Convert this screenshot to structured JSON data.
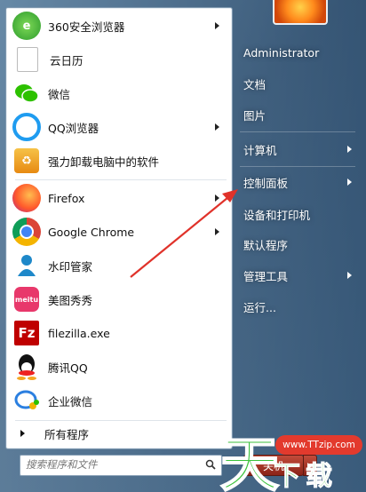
{
  "left_items": [
    {
      "label": "360安全浏览器",
      "icon": "browser-360-icon",
      "has_arrow": true
    },
    {
      "label": "云日历",
      "icon": "calendar-icon",
      "has_arrow": false
    },
    {
      "label": "微信",
      "icon": "wechat-icon",
      "has_arrow": false
    },
    {
      "label": "QQ浏览器",
      "icon": "qq-browser-icon",
      "has_arrow": true
    },
    {
      "label": "强力卸载电脑中的软件",
      "icon": "uninstall-icon",
      "has_arrow": false
    },
    {
      "label": "Firefox",
      "icon": "firefox-icon",
      "has_arrow": true
    },
    {
      "label": "Google Chrome",
      "icon": "chrome-icon",
      "has_arrow": true
    },
    {
      "label": "水印管家",
      "icon": "watermark-icon",
      "has_arrow": false
    },
    {
      "label": "美图秀秀",
      "icon": "meitu-icon",
      "has_arrow": false
    },
    {
      "label": "filezilla.exe",
      "icon": "filezilla-icon",
      "has_arrow": false
    },
    {
      "label": "腾讯QQ",
      "icon": "qq-icon",
      "has_arrow": false
    },
    {
      "label": "企业微信",
      "icon": "wework-icon",
      "has_arrow": false
    }
  ],
  "all_programs": "所有程序",
  "search": {
    "placeholder": "搜索程序和文件"
  },
  "right_items": [
    {
      "label": "Administrator",
      "has_arrow": false
    },
    {
      "label": "文档",
      "has_arrow": false
    },
    {
      "label": "图片",
      "has_arrow": false
    },
    {
      "label": "计算机",
      "has_arrow": true
    },
    {
      "label": "控制面板",
      "has_arrow": true
    },
    {
      "label": "设备和打印机",
      "has_arrow": false
    },
    {
      "label": "默认程序",
      "has_arrow": false
    },
    {
      "label": "管理工具",
      "has_arrow": true
    },
    {
      "label": "运行...",
      "has_arrow": false
    }
  ],
  "shutdown_label": "关机",
  "watermark": {
    "url": "www.TTzip.com",
    "logo_text": "天下载"
  },
  "colors": {
    "annotation_arrow": "#e0322a",
    "watermark_red": "#e33a2d"
  }
}
